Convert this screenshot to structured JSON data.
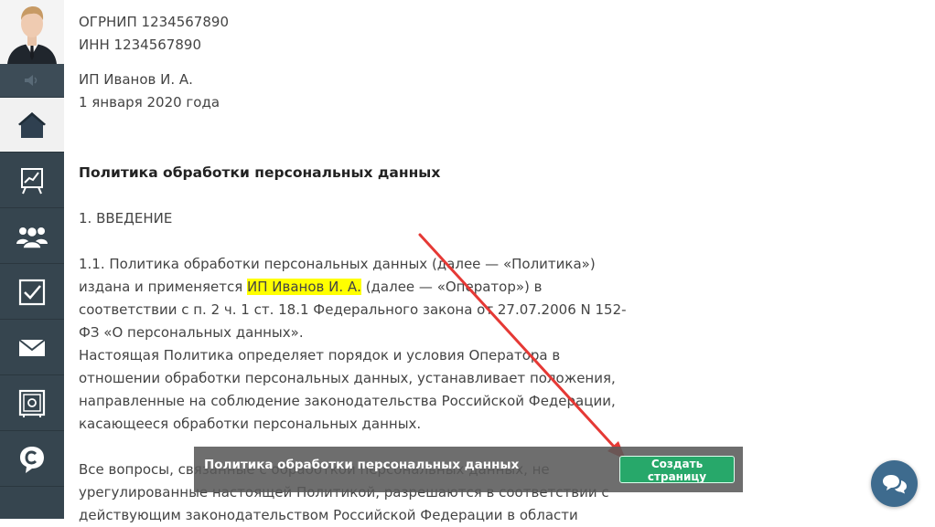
{
  "sidebar": {
    "items": [
      {
        "icon": "home-icon",
        "active": true
      },
      {
        "icon": "chart-board-icon",
        "active": false
      },
      {
        "icon": "users-icon",
        "active": false
      },
      {
        "icon": "checkbox-icon",
        "active": false
      },
      {
        "icon": "mail-icon",
        "active": false
      },
      {
        "icon": "safe-icon",
        "active": false
      },
      {
        "icon": "chat-c-icon",
        "active": false
      }
    ]
  },
  "document": {
    "ogrnip": "ОГРНИП 1234567890",
    "inn": "ИНН 1234567890",
    "ip_name": "ИП Иванов И. А.",
    "date": "1 января 2020 года",
    "title": "Политика обработки персональных данных",
    "section_heading": "1. ВВЕДЕНИЕ",
    "p1_part1": "1.1. Политика обработки персональных данных (далее — «Политика») издана и применяется ",
    "p1_highlight": "ИП Иванов И. А.",
    "p1_part2": " (далее — «Оператор») в соответствии с п. 2 ч. 1 ст. 18.1 Федерального закона от 27.07.2006 N 152-ФЗ «О персональных данных».",
    "p2": "Настоящая Политика определяет порядок и условия Оператора в отношении обработки персональных данных, устанавливает положения, направленные на соблюдение законодательства Российской Федерации, касающееся обработки персональных данных.",
    "p3": "Все вопросы, связанные с обработкой персональных данных, не урегулированные настоящей Политикой, разрешаются в соответствии с действующим законодательством Российской Федерации в области"
  },
  "bottom_bar": {
    "title": "Политика обработки персональных данных",
    "button_label": "Создать страницу"
  },
  "colors": {
    "sidebar_bg": "#36454f",
    "highlight": "#ffff00",
    "button_green": "#27a86a",
    "arrow_red": "#e53935",
    "chat_bubble": "#3e6b8e"
  }
}
